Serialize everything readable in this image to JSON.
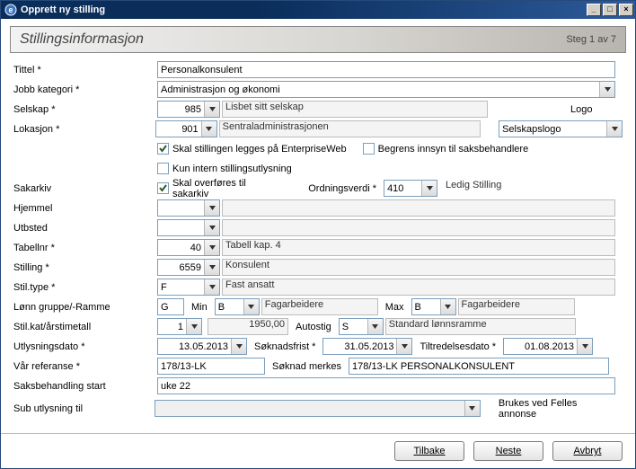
{
  "window": {
    "title": "Opprett ny stilling",
    "buttons": {
      "min": "_",
      "max": "□",
      "close": "×"
    }
  },
  "header": {
    "title": "Stillingsinformasjon",
    "step": "Steg 1 av 7"
  },
  "labels": {
    "tittel": "Tittel *",
    "jobbkategori": "Jobb kategori *",
    "selskap": "Selskap *",
    "lokasjon": "Lokasjon *",
    "sakarkiv": "Sakarkiv",
    "hjemmel": "Hjemmel",
    "utbsted": "Utbsted",
    "tabellnr": "Tabellnr *",
    "stilling": "Stilling *",
    "stiltype": "Stil.type *",
    "lonn": "Lønn gruppe/-Ramme",
    "stilkat": "Stil.kat/årstimetall",
    "utlysningsdato": "Utlysningsdato *",
    "varref": "Vår referanse *",
    "saksbeh": "Saksbehandling start",
    "subut": "Sub utlysning til",
    "logo": "Logo",
    "ordningsverdi": "Ordningsverdi *",
    "min": "Min",
    "max": "Max",
    "autostig": "Autostig",
    "soknadsfrist": "Søknadsfrist *",
    "tiltredelsesdato": "Tiltredelsesdato *",
    "soknadmerkes": "Søknad merkes",
    "brukes": "Brukes ved Felles annonse"
  },
  "values": {
    "tittel": "Personalkonsulent",
    "jobbkategori": "Administrasjon og økonomi",
    "selskap_id": "985",
    "selskap_name": "Lisbet sitt selskap",
    "lokasjon_id": "901",
    "lokasjon_name": "Sentraladministrasjonen",
    "logo": "Selskapslogo",
    "cb_enterpriseweb": "Skal stillingen legges på EnterpriseWeb",
    "cb_enterpriseweb_checked": true,
    "cb_begrens": "Begrens innsyn til saksbehandlere",
    "cb_begrens_checked": false,
    "cb_kunintern": "Kun intern stillingsutlysning",
    "cb_kunintern_checked": false,
    "cb_sakarkiv": "Skal overføres til sakarkiv",
    "cb_sakarkiv_checked": true,
    "ordningsverdi": "410",
    "ordningsverdi_desc": "Ledig Stilling",
    "tabellnr": "40",
    "tabellnr_desc": "Tabell kap. 4",
    "stilling": "6559",
    "stilling_desc": "Konsulent",
    "stiltype": "F",
    "stiltype_desc": "Fast ansatt",
    "lonn_g": "G",
    "lonn_min": "B",
    "lonn_min_desc": "Fagarbeidere",
    "lonn_max": "B",
    "lonn_max_desc": "Fagarbeidere",
    "stilkat": "1",
    "stilkat_tall": "1950,00",
    "autostig": "S",
    "autostig_desc": "Standard lønnsramme",
    "utlysningsdato": "13.05.2013",
    "soknadsfrist": "31.05.2013",
    "tiltredelsesdato": "01.08.2013",
    "varref": "178/13-LK",
    "soknadmerkes_val": "178/13-LK PERSONALKONSULENT",
    "saksbeh_val": "uke 22"
  },
  "footer": {
    "tilbake": "Tilbake",
    "neste": "Neste",
    "avbryt": "Avbryt"
  }
}
